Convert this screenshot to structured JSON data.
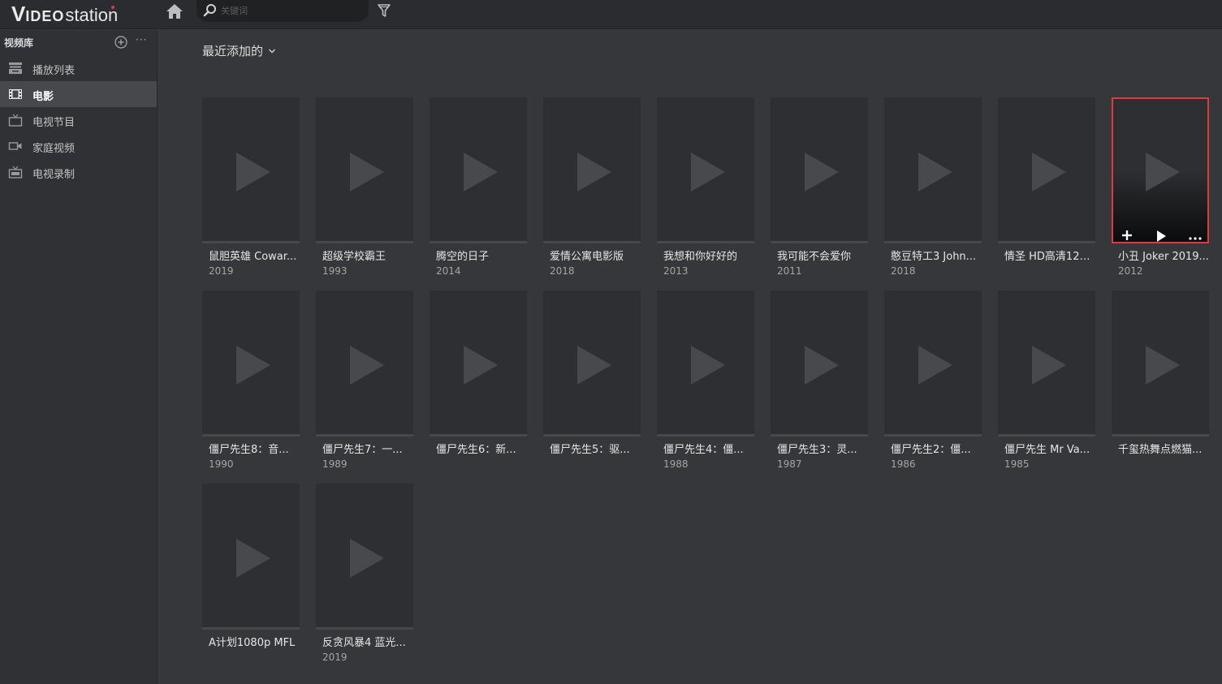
{
  "app": {
    "logo_part1": "V",
    "logo_part2": "IDEO",
    "logo_part3": "station"
  },
  "search": {
    "placeholder": "关键词"
  },
  "sidebar": {
    "library_title": "视频库",
    "more_label": "···",
    "items": [
      {
        "label": "播放列表",
        "icon": "playlist-icon"
      },
      {
        "label": "电影",
        "icon": "movie-icon",
        "active": true
      },
      {
        "label": "电视节目",
        "icon": "tv-icon"
      },
      {
        "label": "家庭视频",
        "icon": "camera-icon"
      },
      {
        "label": "电视录制",
        "icon": "tv-record-icon"
      }
    ]
  },
  "main": {
    "sort_label": "最近添加的",
    "videos": [
      {
        "title": "鼠胆英雄 Cowar...",
        "year": "2019"
      },
      {
        "title": "超级学校霸王",
        "year": "1993"
      },
      {
        "title": "腾空的日子",
        "year": "2014"
      },
      {
        "title": "爱情公寓电影版",
        "year": "2018"
      },
      {
        "title": "我想和你好好的",
        "year": "2013"
      },
      {
        "title": "我可能不会爱你",
        "year": "2011"
      },
      {
        "title": "憨豆特工3 John...",
        "year": "2018"
      },
      {
        "title": "情圣 HD高清128...",
        "year": ""
      },
      {
        "title": "小丑 Joker 2019...",
        "year": "2012",
        "hover": true
      },
      {
        "title": "僵尸先生8：音...",
        "year": "1990"
      },
      {
        "title": "僵尸先生7：一...",
        "year": "1989"
      },
      {
        "title": "僵尸先生6：新...",
        "year": ""
      },
      {
        "title": "僵尸先生5：驱...",
        "year": ""
      },
      {
        "title": "僵尸先生4：僵...",
        "year": "1988"
      },
      {
        "title": "僵尸先生3：灵...",
        "year": "1987"
      },
      {
        "title": "僵尸先生2：僵...",
        "year": "1986"
      },
      {
        "title": "僵尸先生 Mr Va...",
        "year": "1985"
      },
      {
        "title": "千玺热舞点燃猫...",
        "year": ""
      },
      {
        "title": "A计划1080p MFL",
        "year": ""
      },
      {
        "title": "反贪风暴4 蓝光...",
        "year": "2019"
      }
    ]
  },
  "colors": {
    "accent": "#e03b3b",
    "background": "#35373a",
    "sidebar": "#2f3134",
    "topbar": "#2a2c2f"
  }
}
